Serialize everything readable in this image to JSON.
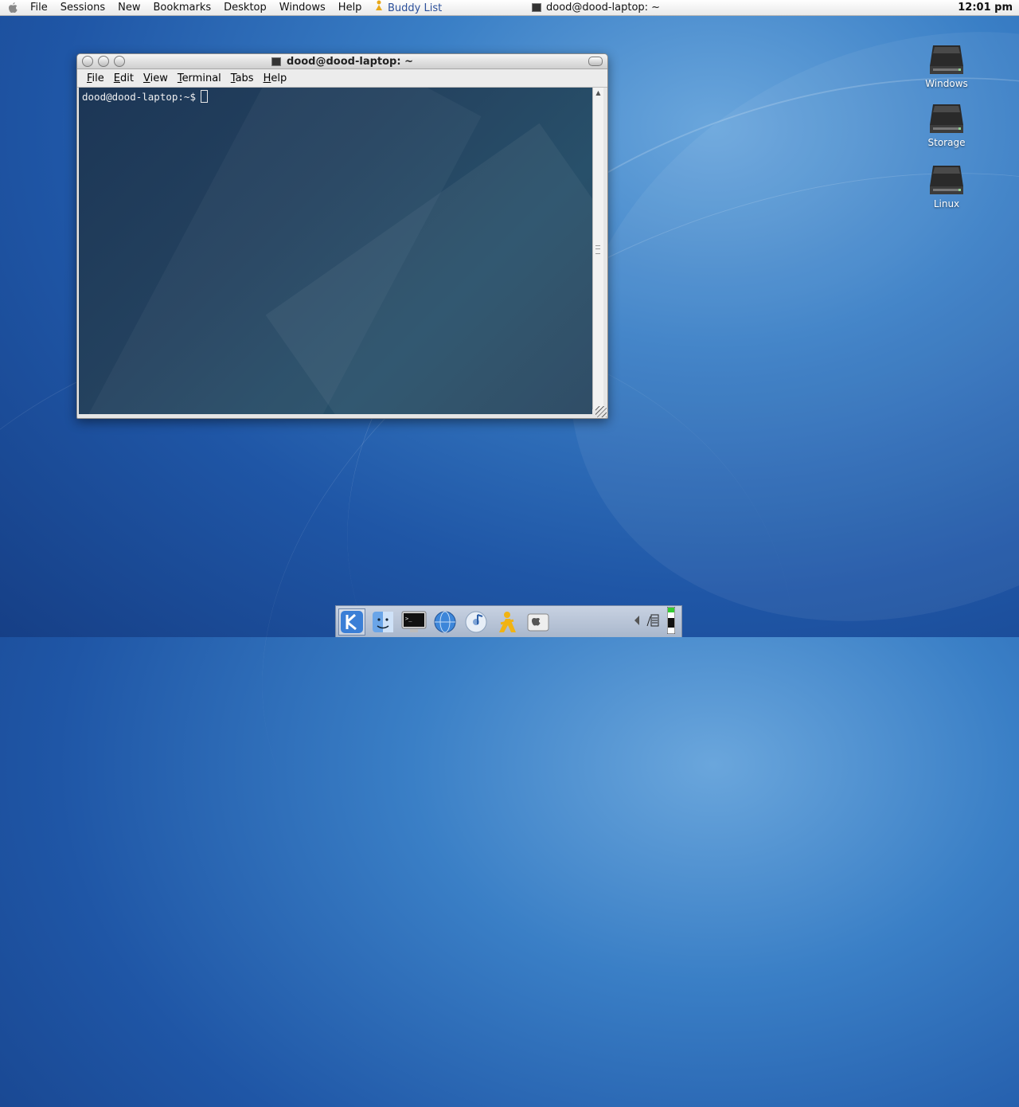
{
  "menubar": {
    "items": [
      "File",
      "Sessions",
      "New",
      "Bookmarks",
      "Desktop",
      "Windows",
      "Help"
    ],
    "taskbar_buddy": "Buddy List",
    "taskbar_window": "dood@dood-laptop: ~",
    "clock": "12:01 pm"
  },
  "desktop": {
    "icons": [
      {
        "label": "Windows",
        "icon": "hard-drive-icon"
      },
      {
        "label": "Storage",
        "icon": "hard-drive-icon"
      },
      {
        "label": "Linux",
        "icon": "hard-drive-icon"
      }
    ]
  },
  "terminal": {
    "title": "dood@dood-laptop: ~",
    "menu": [
      "File",
      "Edit",
      "View",
      "Terminal",
      "Tabs",
      "Help"
    ],
    "prompt": "dood@dood-laptop:~$"
  },
  "dock": {
    "items": [
      "kde-menu-icon",
      "finder-icon",
      "terminal-icon",
      "browser-icon",
      "itunes-icon",
      "aim-icon",
      "system-prefs-icon"
    ],
    "tray": [
      "volume-icon",
      "network-icon",
      "battery-icon"
    ]
  },
  "colors": {
    "wallpaper": "#2a63b0",
    "terminal_bg": "#213e5c",
    "buddy_link": "#2b4f9a"
  }
}
